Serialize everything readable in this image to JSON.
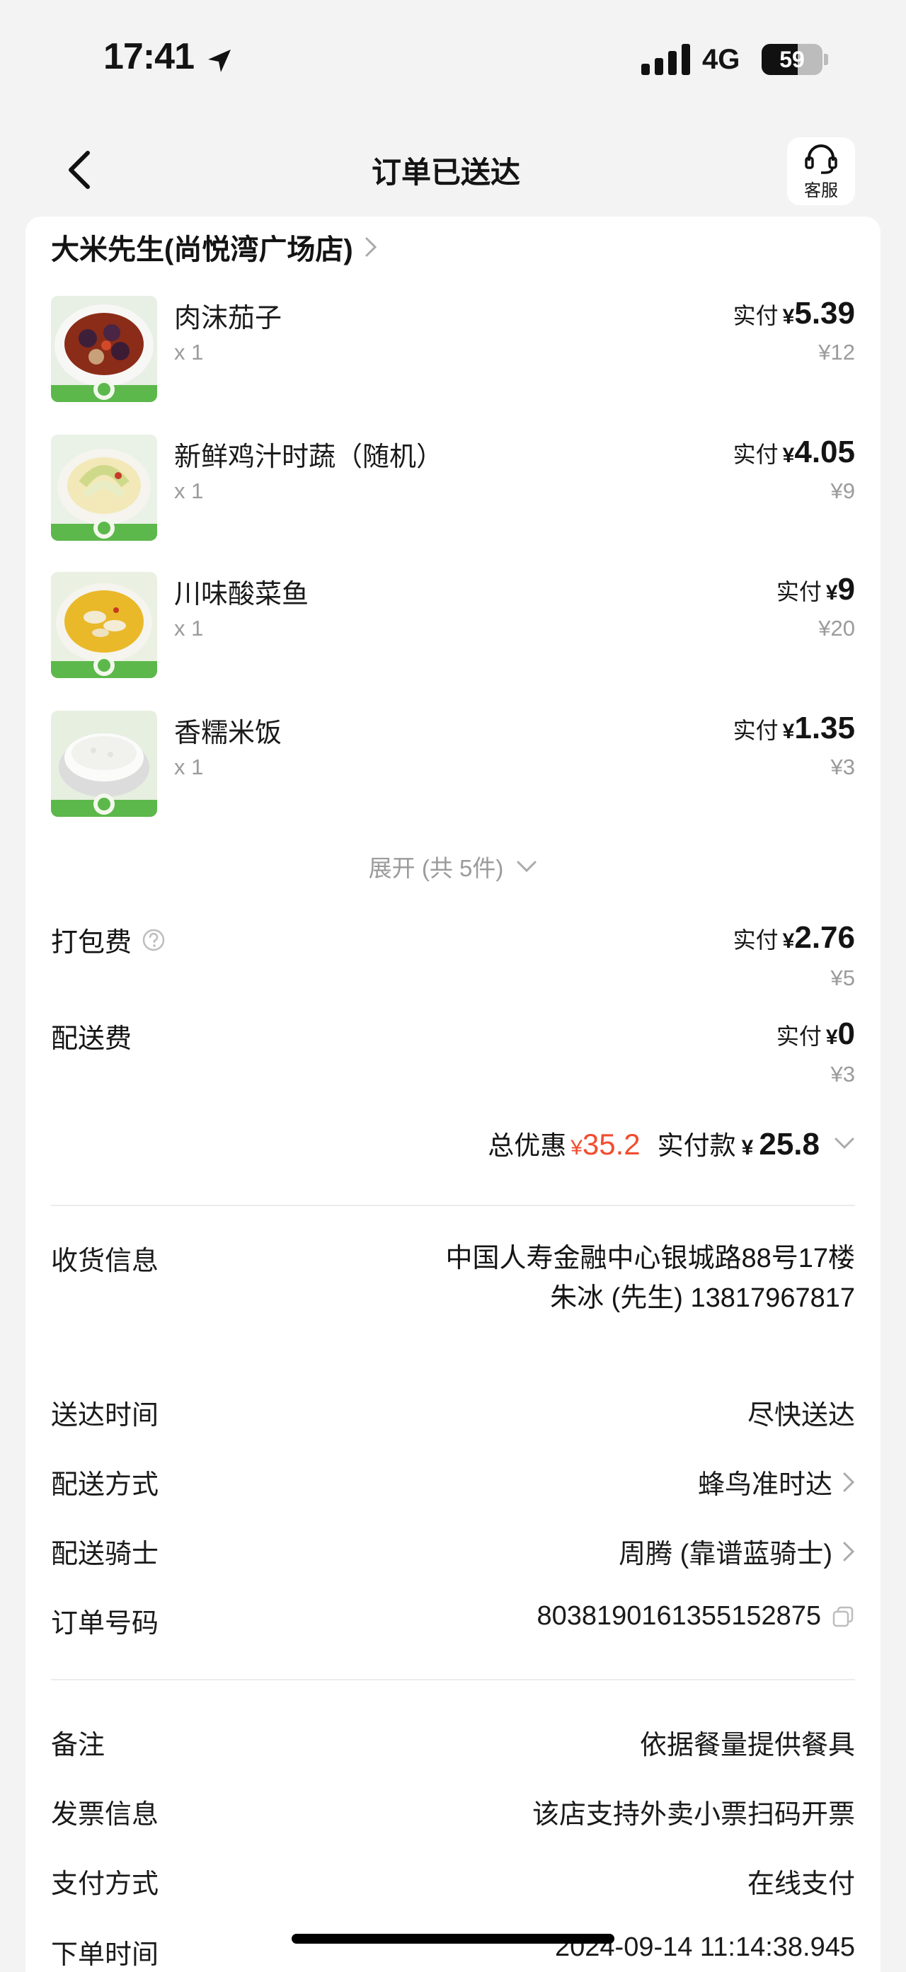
{
  "status_bar": {
    "time": "17:41",
    "network": "4G",
    "battery_level": "59",
    "battery_fraction": 0.59
  },
  "nav": {
    "title": "订单已送达",
    "service_label": "客服"
  },
  "store": {
    "name": "大米先生(尚悦湾广场店)"
  },
  "items": [
    {
      "name": "肉沫茄子",
      "qty": "x 1",
      "paid_label": "实付",
      "currency": "¥",
      "paid": "5.39",
      "original": "¥12",
      "thumb": "eggplant"
    },
    {
      "name": "新鲜鸡汁时蔬（随机）",
      "qty": "x 1",
      "paid_label": "实付",
      "currency": "¥",
      "paid": "4.05",
      "original": "¥9",
      "thumb": "greens"
    },
    {
      "name": "川味酸菜鱼",
      "qty": "x 1",
      "paid_label": "实付",
      "currency": "¥",
      "paid": "9",
      "original": "¥20",
      "thumb": "fish"
    },
    {
      "name": "香糯米饭",
      "qty": "x 1",
      "paid_label": "实付",
      "currency": "¥",
      "paid": "1.35",
      "original": "¥3",
      "thumb": "rice"
    }
  ],
  "expand_label": "展开 (共 5件)",
  "fees": {
    "packing": {
      "label": "打包费",
      "paid_label": "实付",
      "currency": "¥",
      "paid": "2.76",
      "original": "¥5"
    },
    "delivery": {
      "label": "配送费",
      "paid_label": "实付",
      "currency": "¥",
      "paid": "0",
      "original": "¥3"
    }
  },
  "summary": {
    "discount_label": "总优惠",
    "discount_currency": "¥",
    "discount": "35.2",
    "total_label": "实付款",
    "total_currency": "¥",
    "total": "25.8"
  },
  "delivery_info": {
    "receiver_label": "收货信息",
    "address": "中国人寿金融中心银城路88号17楼",
    "contact": "朱冰 (先生) 13817967817",
    "time_label": "送达时间",
    "time_value": "尽快送达",
    "method_label": "配送方式",
    "method_value": "蜂鸟准时达",
    "rider_label": "配送骑士",
    "rider_value": "周腾 (靠谱蓝骑士)",
    "order_no_label": "订单号码",
    "order_no": "8038190161355152875"
  },
  "order_info": {
    "note_label": "备注",
    "note_value": "依据餐量提供餐具",
    "invoice_label": "发票信息",
    "invoice_value": "该店支持外卖小票扫码开票",
    "payment_label": "支付方式",
    "payment_value": "在线支付",
    "order_time_label": "下单时间",
    "order_time_value": "2024-09-14 11:14:38.945"
  },
  "icons": {
    "back": "chevron-left-icon",
    "service": "headset-icon",
    "location": "location-arrow-icon",
    "signal": "signal-bars-icon",
    "help": "question-circle-icon",
    "copy": "copy-icon"
  },
  "colors": {
    "discount": "#f24d2f",
    "page_bg": "#f3f3f3",
    "card_bg": "#ffffff",
    "secondary_text": "#9b9b9b"
  }
}
